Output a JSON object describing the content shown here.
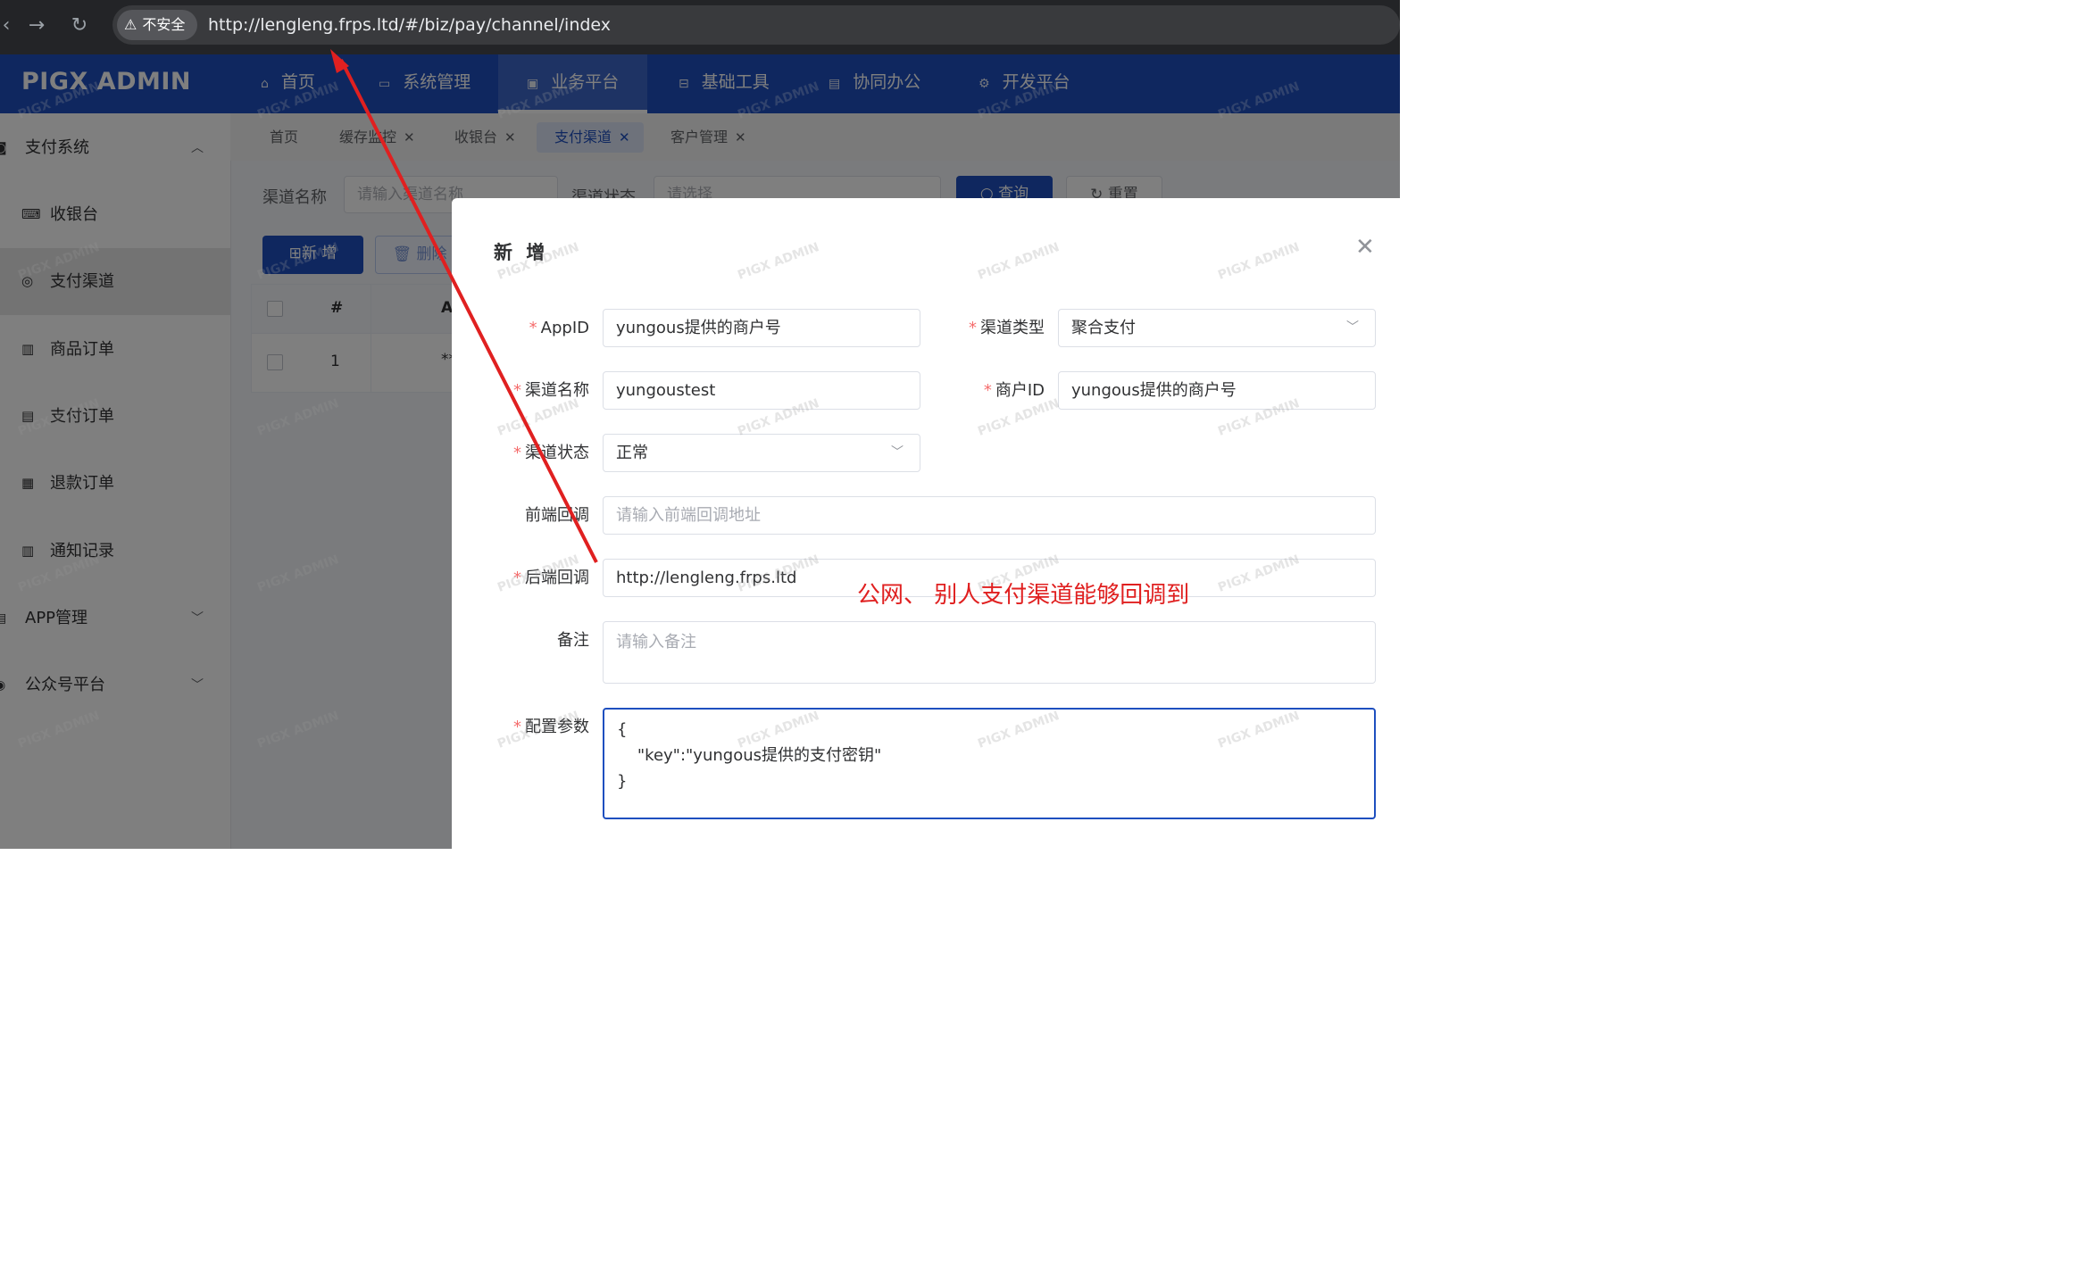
{
  "browser": {
    "security_label": "不安全",
    "url": "http://lengleng.frps.ltd/#/biz/pay/channel/index"
  },
  "app": {
    "logo": "PIGX ADMIN",
    "top_nav": [
      {
        "label": "首页",
        "icon": "home-icon"
      },
      {
        "label": "系统管理",
        "icon": "monitor-icon"
      },
      {
        "label": "业务平台",
        "icon": "screen-icon"
      },
      {
        "label": "基础工具",
        "icon": "briefcase-icon"
      },
      {
        "label": "协同办公",
        "icon": "id-card-icon"
      },
      {
        "label": "开发平台",
        "icon": "gear-icon"
      }
    ],
    "active_top_nav": "业务平台",
    "watermark": "PIGX ADMIN"
  },
  "tabs": [
    {
      "label": "首页",
      "closable": false
    },
    {
      "label": "缓存监控",
      "closable": true
    },
    {
      "label": "收银台",
      "closable": true
    },
    {
      "label": "支付渠道",
      "closable": true,
      "active": true
    },
    {
      "label": "客户管理",
      "closable": true
    }
  ],
  "sidebar": {
    "group_pay": "支付系统",
    "items": [
      {
        "label": "收银台"
      },
      {
        "label": "支付渠道",
        "active": true
      },
      {
        "label": "商品订单"
      },
      {
        "label": "支付订单"
      },
      {
        "label": "退款订单"
      },
      {
        "label": "通知记录"
      }
    ],
    "group_app": "APP管理",
    "group_wechat": "公众号平台"
  },
  "search": {
    "channel_name_label": "渠道名称",
    "channel_name_placeholder": "请输入渠道名称",
    "channel_status_label": "渠道状态",
    "channel_status_placeholder": "请选择",
    "query_button": "查询",
    "reset_button": "重置"
  },
  "toolbar": {
    "add_button": "新 增",
    "delete_button": "删除"
  },
  "table": {
    "col_index": "#",
    "col_a": "A",
    "row1_index": "1",
    "row1_a": "**"
  },
  "modal": {
    "title": "新 增",
    "fields": {
      "appid_label": "AppID",
      "appid_value": "yungous提供的商户号",
      "channel_type_label": "渠道类型",
      "channel_type_value": "聚合支付",
      "channel_name_label": "渠道名称",
      "channel_name_value": "yungoustest",
      "merchant_id_label": "商户ID",
      "merchant_id_value": "yungous提供的商户号",
      "channel_status_label": "渠道状态",
      "channel_status_value": "正常",
      "frontend_callback_label": "前端回调",
      "frontend_callback_placeholder": "请输入前端回调地址",
      "backend_callback_label": "后端回调",
      "backend_callback_value": "http://lengleng.frps.ltd",
      "remark_label": "备注",
      "remark_placeholder": "请输入备注",
      "config_label": "配置参数",
      "config_value": "{\n    \"key\":\"yungous提供的支付密钥\"\n}"
    }
  },
  "annotation": {
    "text": "公网、 别人支付渠道能够回调到",
    "color": "#e02020"
  },
  "colors": {
    "brand": "#1e4fbf",
    "required": "#f56c6c"
  }
}
